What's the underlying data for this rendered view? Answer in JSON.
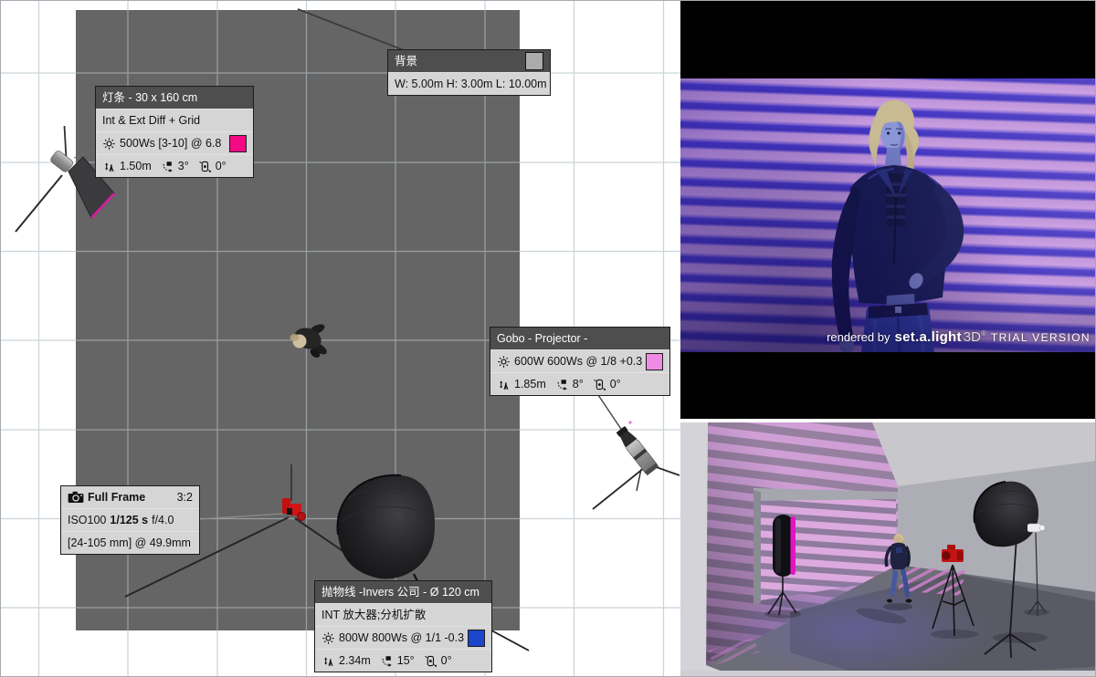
{
  "plan_view": {
    "backdrop_tooltip": {
      "title": "背景",
      "dimensions": "W: 5.00m H: 3.00m L: 10.00m",
      "swatch_color": "#ababab"
    },
    "strip_light_tooltip": {
      "title": "灯条 - 30 x 160 cm",
      "modifier": "Int & Ext Diff + Grid",
      "power": "500Ws [3-10] @ 6.8",
      "swatch_color": "#f30b86",
      "stand_height": "1.50m",
      "tilt_angle": "3°",
      "roll_angle": "0°"
    },
    "gobo_tooltip": {
      "title": "Gobo - Projector -",
      "power": "600W 600Ws @ 1/8 +0.3",
      "swatch_color": "#ef8be4",
      "stand_height": "1.85m",
      "tilt_angle": "8°",
      "roll_angle": "0°"
    },
    "camera_tooltip": {
      "model": "Full Frame",
      "aspect_ratio": "3:2",
      "iso": "ISO100",
      "shutter_speed": "1/125 s",
      "aperture": "f/4.0",
      "lens": "[24-105 mm] @ 49.9mm"
    },
    "parabolic_tooltip": {
      "title": "抛物线 -Invers 公司 - Ø 120 cm",
      "modifier": "INT 放大器;分机扩散",
      "power": "800W 800Ws @ 1/1 -0.3",
      "swatch_color": "#1c45c9",
      "stand_height": "2.34m",
      "tilt_angle": "15°",
      "roll_angle": "0°"
    }
  },
  "render_preview": {
    "watermark_prefix": "rendered by",
    "watermark_brand": "set.a.light",
    "watermark_3d": "3D",
    "watermark_reg": "®",
    "watermark_trial": "TRIAL VERSION"
  },
  "colors": {
    "floor_plan_gray": "#656565",
    "photo_stripe_pink": "#bd92d8",
    "photo_stripe_blue": "#4a3dcb",
    "strip_light_accent": "#e414c4"
  },
  "icons": {
    "power_icon": "☀",
    "stand_height_icon": "↕",
    "tilt_icon": "⤾",
    "roll_icon": "↻",
    "camera_icon": "📷"
  }
}
